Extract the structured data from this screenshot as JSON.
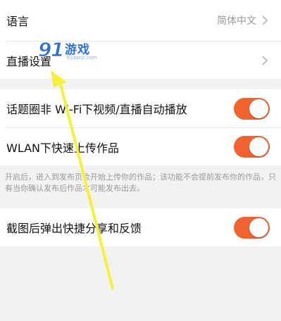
{
  "settings": {
    "language": {
      "label": "语言",
      "value": "简体中文"
    },
    "live_settings": {
      "label": "直播设置"
    },
    "autoplay": {
      "label": "话题圈非 Wi-Fi下视频/直播自动播放",
      "enabled": true
    },
    "wlan_upload": {
      "label": "WLAN下快速上传作品",
      "enabled": true
    },
    "upload_note": "开启后，进入到发布页会开始上传你的作品；该功能不会提前发布你的作品，只有当你确认发布后作品才可能发布出去。",
    "screenshot_share": {
      "label": "截图后弹出快捷分享和反馈",
      "enabled": true
    }
  },
  "watermark": {
    "logo_text": "游戏",
    "domain": "91danji.com"
  },
  "colors": {
    "toggle_on": "#f2622e",
    "arrow": "#f5f03a",
    "background": "#f2f2f2"
  }
}
